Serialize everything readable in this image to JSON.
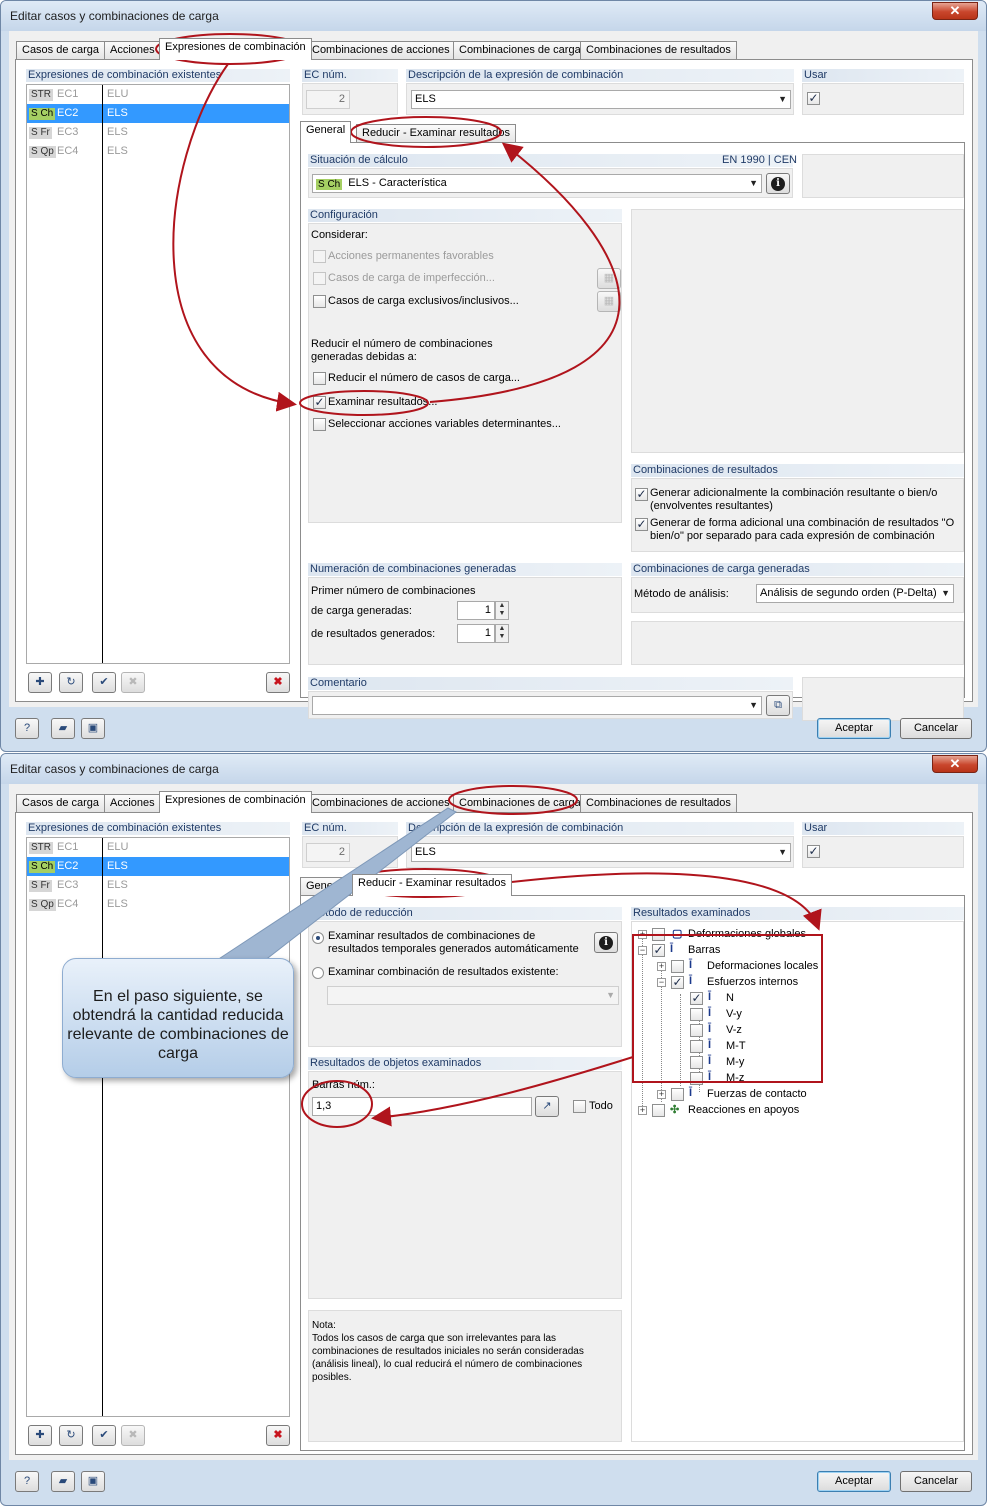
{
  "window_title": "Editar casos y combinaciones de carga",
  "close_glyph": "✕",
  "tabs": [
    "Casos de carga",
    "Acciones",
    "Expresiones de combinación",
    "Combinaciones de acciones",
    "Combinaciones de carga",
    "Combinaciones de resultados"
  ],
  "subtabs": [
    "General",
    "Reducir - Examinar resultados"
  ],
  "list": {
    "header": "Expresiones de combinación existentes",
    "rows": [
      {
        "badge": "STR",
        "code": "EC1",
        "desc": "ELU"
      },
      {
        "badge": "S Ch",
        "code": "EC2",
        "desc": "ELS"
      },
      {
        "badge": "S Fr",
        "code": "EC3",
        "desc": "ELS"
      },
      {
        "badge": "S Qp",
        "code": "EC4",
        "desc": "ELS"
      }
    ]
  },
  "ec_num": {
    "label": "EC núm.",
    "value": "2"
  },
  "description": {
    "label": "Descripción de la expresión de combinación",
    "value": "ELS"
  },
  "use": {
    "label": "Usar"
  },
  "situation": {
    "label": "Situación de cálculo",
    "norm": "EN 1990 | CEN",
    "badge": "S Ch",
    "value": "ELS - Característica"
  },
  "config": {
    "header": "Configuración",
    "consider": "Considerar:",
    "opt1": "Acciones permanentes favorables",
    "opt2": "Casos de carga de imperfección...",
    "opt3": "Casos de carga exclusivos/inclusivos...",
    "reduce_text": "Reducir el número de combinaciones generadas debidas a:",
    "opt4": "Reducir el número de casos de carga...",
    "opt5": "Examinar resultados...",
    "opt6": "Seleccionar acciones variables determinantes..."
  },
  "result_combos": {
    "header": "Combinaciones de resultados",
    "opt1": "Generar adicionalmente la combinación resultante o bien/o (envolventes resultantes)",
    "opt2": "Generar de forma adicional una combinación de resultados \"O bien/o\" por separado para cada expresión de combinación"
  },
  "numbering": {
    "header": "Numeración de combinaciones generadas",
    "first": "Primer número de combinaciones",
    "load": "de carga generadas:",
    "load_val": "1",
    "results": "de resultados generados:",
    "results_val": "1"
  },
  "generated": {
    "header": "Combinaciones de carga generadas",
    "method_label": "Método de análisis:",
    "method_value": "Análisis de segundo orden (P-Delta)"
  },
  "comment": {
    "label": "Comentario"
  },
  "buttons": {
    "ok": "Aceptar",
    "cancel": "Cancelar"
  },
  "toolbar": {
    "new": "✚",
    "edit": "↻",
    "check": "✔",
    "delete_dis": "✖",
    "delete": "✖",
    "help": "?",
    "open": "▰",
    "save": "▣",
    "pick": "↗",
    "copy": "⧉",
    "imp": "▦"
  },
  "reduce": {
    "method_header": "Método de reducción",
    "radio1": "Examinar resultados de combinaciones de resultados temporales generados automáticamente",
    "radio2": "Examinar combinación de resultados existente:",
    "objects_header": "Resultados de objetos examinados",
    "members_label": "Barras núm.:",
    "members_value": "1,3",
    "all": "Todo",
    "note": "Nota:\nTodos los casos de carga que son irrelevantes para las combinaciones de resultados iniciales no serán consideradas (análisis lineal), lo cual reducirá el número de combinaciones posibles.",
    "examined_header": "Resultados examinados",
    "tree": [
      "Deformaciones globales",
      "Barras",
      "Deformaciones locales",
      "Esfuerzos internos",
      "N",
      "V-y",
      "V-z",
      "M-T",
      "M-y",
      "M-z",
      "Fuerzas de contacto",
      "Reacciones en apoyos"
    ]
  },
  "callout": "En el paso siguiente, se obtendrá la cantidad reducida relevante de combinaciones de carga",
  "colors": {
    "selection": "#3399ff",
    "annotation": "#b0141c",
    "badge_green": "#a5cf63"
  }
}
